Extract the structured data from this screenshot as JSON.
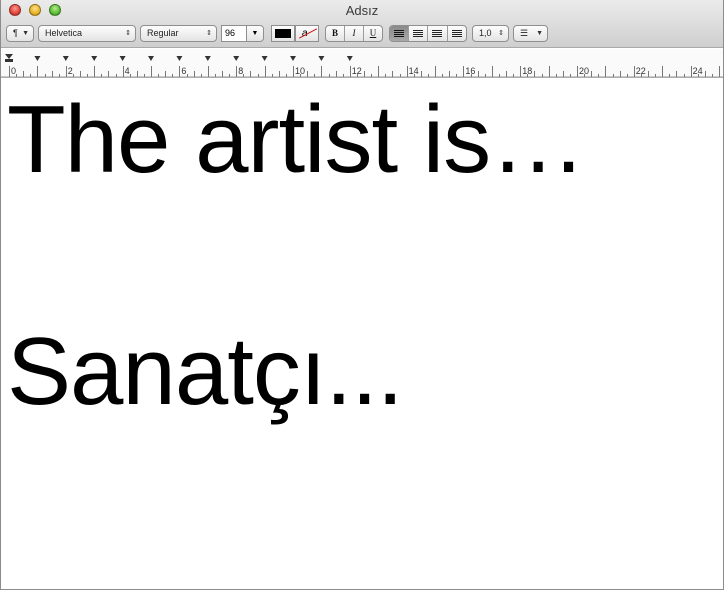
{
  "window": {
    "title": "Adsız"
  },
  "toolbar": {
    "paragraph_menu": "¶",
    "font_family": "Helvetica",
    "font_style": "Regular",
    "font_size": "96",
    "text_color": "#000000",
    "highlight_glyph": "a",
    "bold": "B",
    "italic": "I",
    "underline": "U",
    "line_spacing": "1,0",
    "list_glyph": "☰"
  },
  "ruler": {
    "labels": [
      "0",
      "2",
      "4",
      "6",
      "8",
      "10",
      "12",
      "14",
      "16",
      "18",
      "20",
      "22",
      "24"
    ]
  },
  "document": {
    "line1": "The artist is…",
    "line2": "Sanatçı..."
  }
}
